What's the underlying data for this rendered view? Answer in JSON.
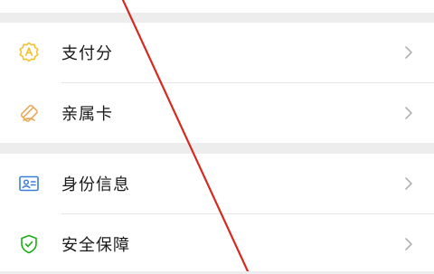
{
  "colors": {
    "background": "#ededed",
    "card": "#ffffff",
    "text": "#1a1a1a",
    "chevron": "#b2b2b2",
    "icon_yellow": "#f2c12e",
    "icon_orange": "#e9a95a",
    "icon_blue": "#3b7ed4",
    "icon_green": "#1aad19",
    "annotation_red": "#d62a1e"
  },
  "menu": {
    "group1": [
      {
        "label": "支付分",
        "icon": "payment-score-icon"
      },
      {
        "label": "亲属卡",
        "icon": "family-card-icon"
      }
    ],
    "group2": [
      {
        "label": "身份信息",
        "icon": "id-card-icon"
      },
      {
        "label": "安全保障",
        "icon": "shield-icon"
      }
    ]
  }
}
